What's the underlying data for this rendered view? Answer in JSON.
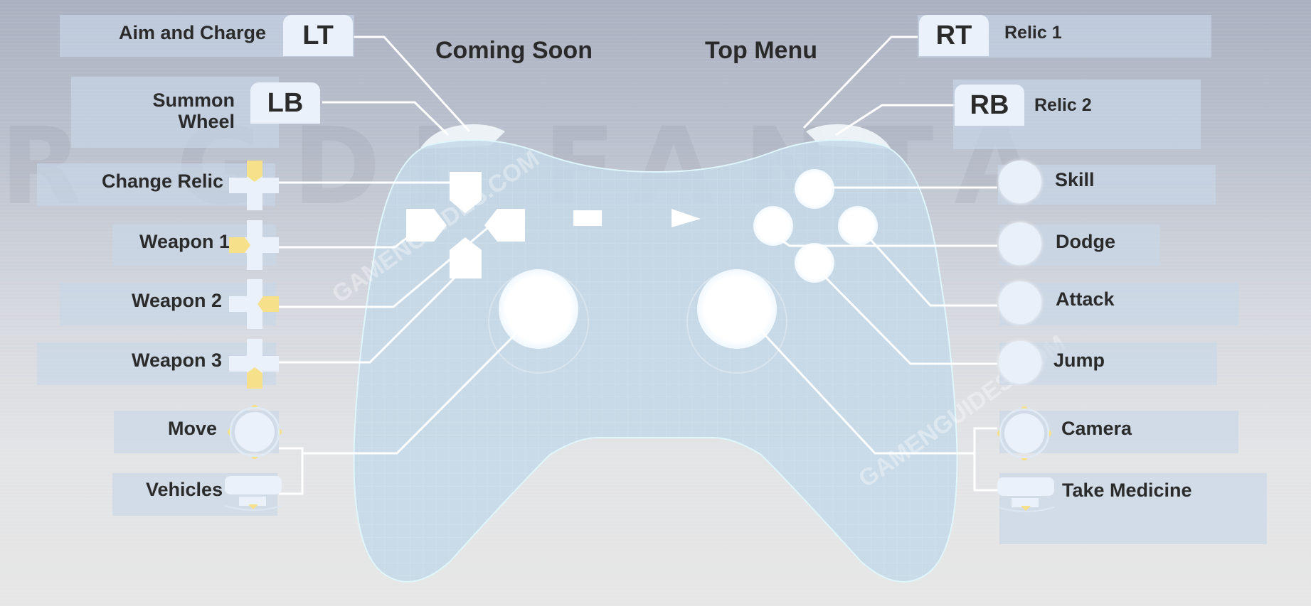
{
  "headers": {
    "lt_rb_middle_left": "Coming Soon",
    "middle_right": "Top Menu"
  },
  "background_text": "R GDI  FANTA",
  "watermark": "GAMENGUIDES.COM",
  "left_bindings": [
    {
      "key": "LT",
      "action": "Aim and Charge"
    },
    {
      "key": "LB",
      "action": "Summon Wheel",
      "action_line1": "Summon",
      "action_line2": "Wheel"
    },
    {
      "key": "dpad-up",
      "action": "Change Relic"
    },
    {
      "key": "dpad-left",
      "action": "Weapon 1"
    },
    {
      "key": "dpad-right",
      "action": "Weapon 2"
    },
    {
      "key": "dpad-down",
      "action": "Weapon 3"
    },
    {
      "key": "left-stick",
      "action": "Move"
    },
    {
      "key": "left-stick-press",
      "action": "Vehicles"
    }
  ],
  "right_bindings": [
    {
      "key": "RT",
      "action": "Relic 1"
    },
    {
      "key": "RB",
      "action": "Relic 2"
    },
    {
      "key": "Y",
      "action": "Skill"
    },
    {
      "key": "X",
      "action": "Dodge"
    },
    {
      "key": "B",
      "action": "Attack"
    },
    {
      "key": "A",
      "action": "Jump"
    },
    {
      "key": "right-stick",
      "action": "Camera"
    },
    {
      "key": "right-stick-press",
      "action": "Take Medicine"
    }
  ],
  "colors": {
    "highlight_yellow": "#f7e08a",
    "controller_fill": "#c4d8e8",
    "controller_outline": "#dff6fb",
    "panel": "#c8d7e8",
    "text": "#2b2b2b"
  }
}
